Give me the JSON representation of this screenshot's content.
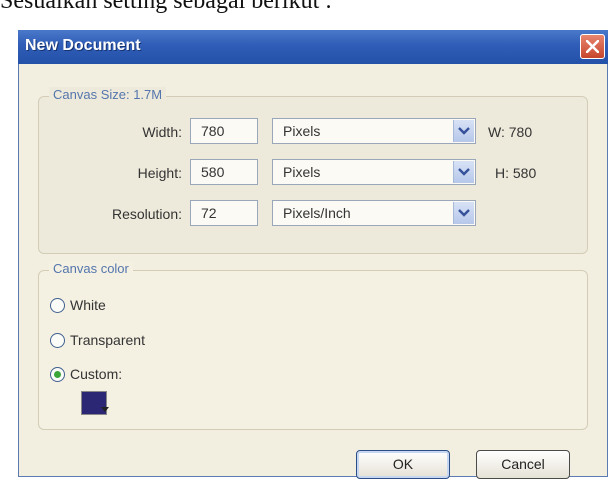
{
  "caption": "Sesuaikan setting sebagai berikut :",
  "dialog": {
    "title": "New Document",
    "close_icon": "close-icon"
  },
  "canvas_size": {
    "legend": "Canvas Size: 1.7M",
    "width": {
      "label": "Width:",
      "value": "780",
      "unit": "Pixels",
      "readout": "W: 780"
    },
    "height": {
      "label": "Height:",
      "value": "580",
      "unit": "Pixels",
      "readout": "H: 580"
    },
    "resolution": {
      "label": "Resolution:",
      "value": "72",
      "unit": "Pixels/Inch"
    }
  },
  "canvas_color": {
    "legend": "Canvas color",
    "options": [
      {
        "label": "White",
        "selected": false
      },
      {
        "label": "Transparent",
        "selected": false
      },
      {
        "label": "Custom:",
        "selected": true
      }
    ],
    "custom_color": "#2b2775"
  },
  "buttons": {
    "ok": "OK",
    "cancel": "Cancel"
  }
}
